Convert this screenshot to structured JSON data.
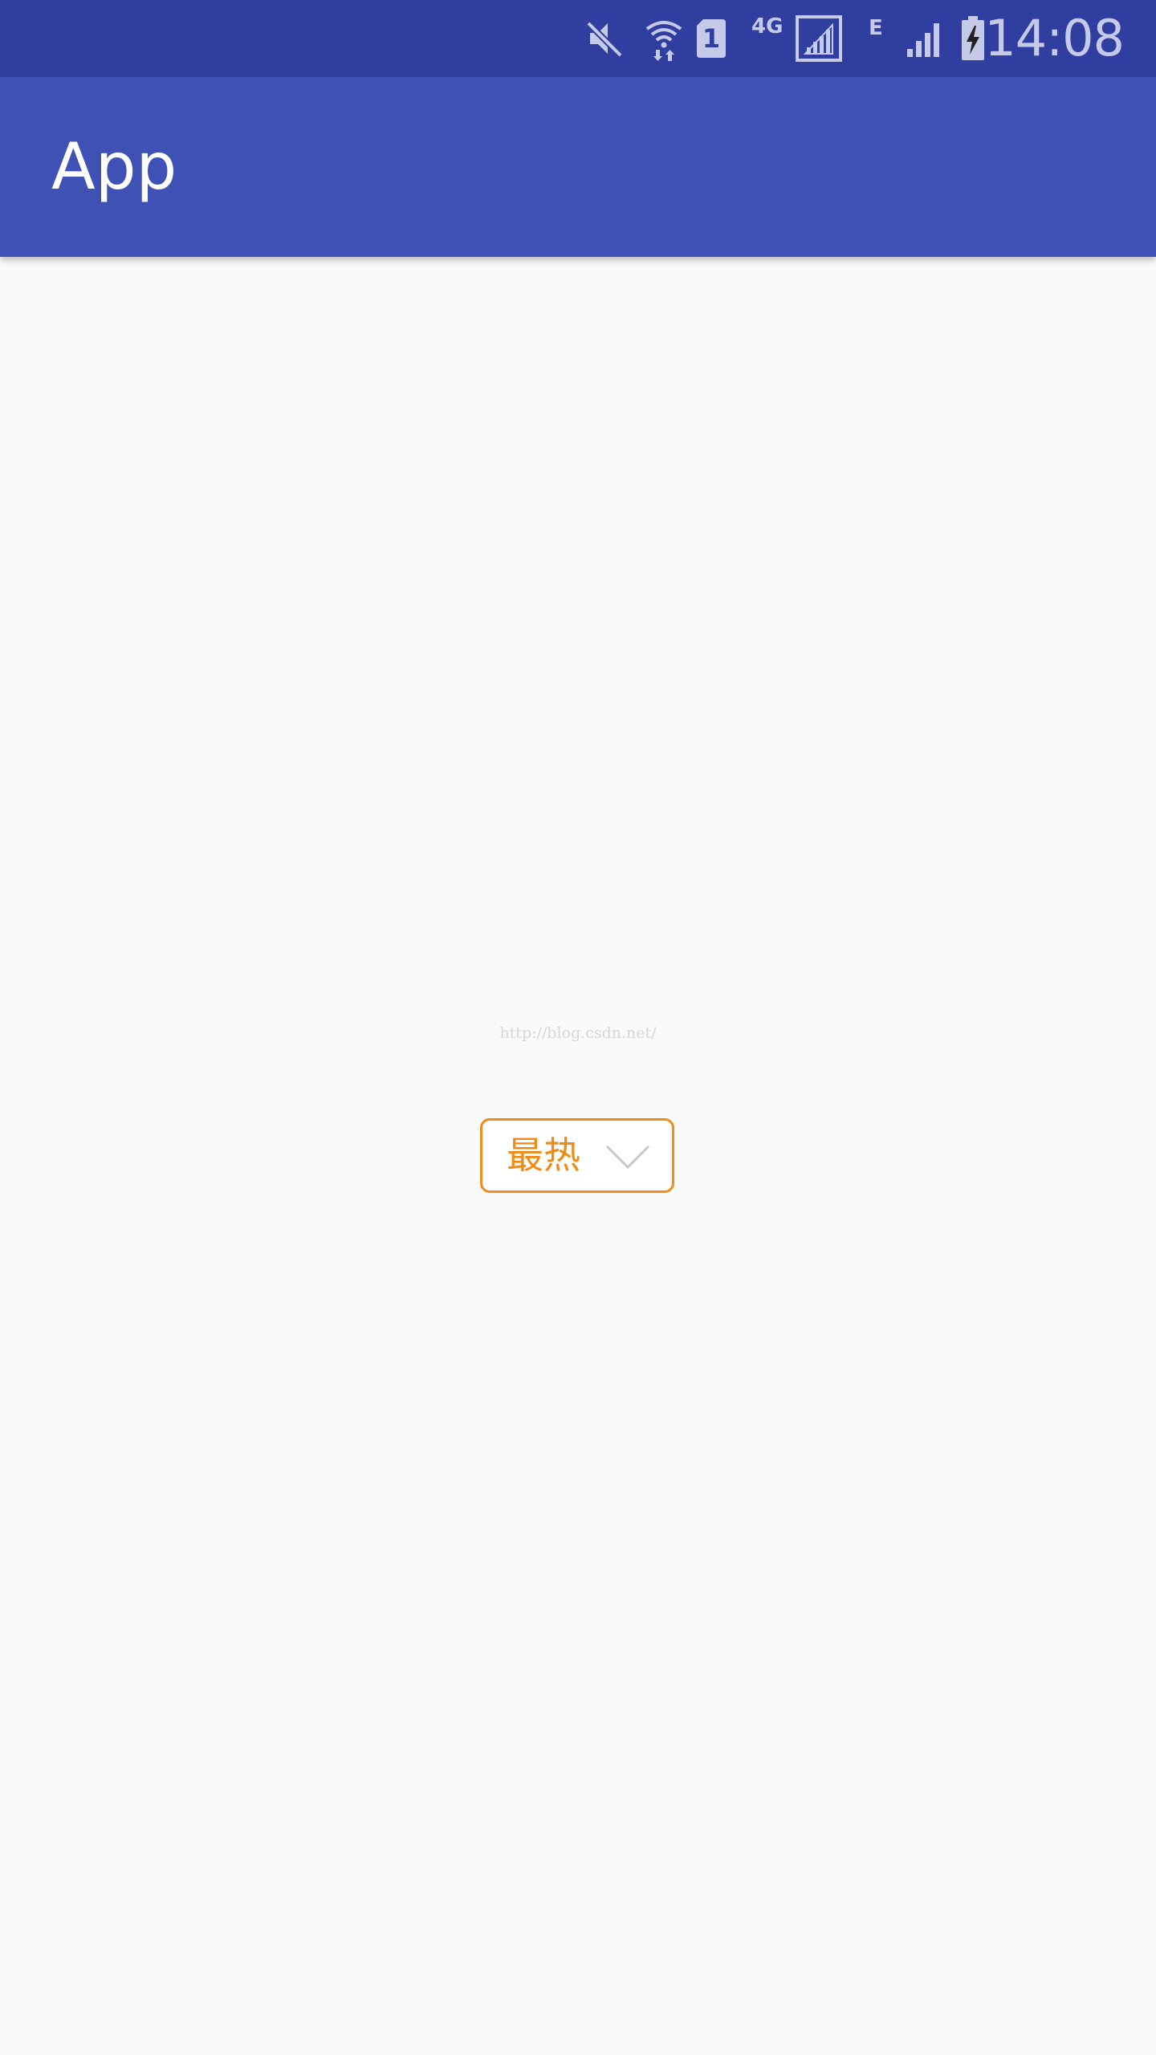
{
  "status_bar": {
    "network_label": "4G",
    "sim_label": "1",
    "edge_label": "E",
    "time": "14:08",
    "icons": [
      "mute-icon",
      "wifi-icon",
      "sim-card-icon",
      "signal-icon",
      "edge-signal-icon",
      "battery-charging-icon"
    ]
  },
  "app_bar": {
    "title": "App"
  },
  "watermark": {
    "text": "http://blog.csdn.net/"
  },
  "dropdown": {
    "selected": "最热",
    "border_color": "#f08c1c",
    "text_color": "#ef8a17"
  },
  "colors": {
    "status_bar": "#303f9f",
    "app_bar": "#3f51b5",
    "background": "#fafafa"
  }
}
